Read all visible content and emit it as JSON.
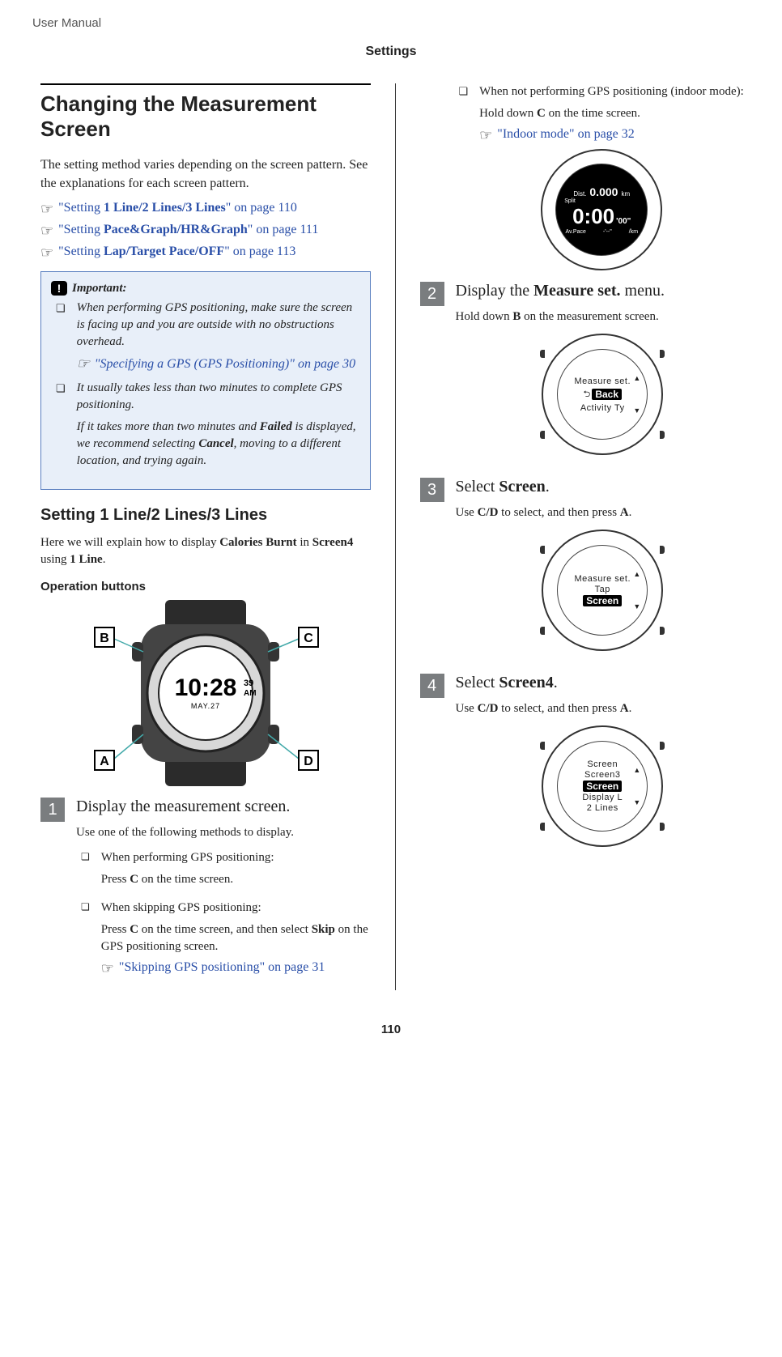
{
  "header": {
    "doc_type": "User Manual",
    "section": "Settings"
  },
  "h1": "Changing the Measurement Screen",
  "intro": "The setting method varies depending on the screen pattern. See the explanations for each screen pattern.",
  "xref1": {
    "prefix": "\"Setting ",
    "bold": "1 Line/2 Lines/3 Lines",
    "suffix": "\" on page 110"
  },
  "xref2": {
    "prefix": "\"Setting ",
    "bold": "Pace&Graph/HR&Graph",
    "suffix": "\" on page 111"
  },
  "xref3": {
    "prefix": "\"Setting ",
    "bold": "Lap/Target Pace/OFF",
    "suffix": "\" on page 113"
  },
  "important": {
    "label": "Important:",
    "item1": {
      "text": "When performing GPS positioning, make sure the screen is facing up and you are outside with no obstructions overhead.",
      "xref": "\"Specifying a GPS (GPS Positioning)\" on page 30"
    },
    "item2": {
      "text": "It usually takes less than two minutes to complete GPS positioning.",
      "text2_a": "If it takes more than two minutes and ",
      "text2_b": "Failed",
      "text2_c": " is displayed, we recommend selecting ",
      "text2_d": "Cancel",
      "text2_e": ", moving to a different location, and trying again."
    }
  },
  "h2": "Setting 1 Line/2 Lines/3 Lines",
  "h2_intro_a": "Here we will explain how to display ",
  "h2_intro_b": "Calories Burnt",
  "h2_intro_c": " in ",
  "h2_intro_d": "Screen4",
  "h2_intro_e": " using ",
  "h2_intro_f": "1 Line",
  "h2_intro_g": ".",
  "op_btn_heading": "Operation buttons",
  "watch_labels": {
    "A": "A",
    "B": "B",
    "C": "C",
    "D": "D",
    "time": "10:28",
    "sec": "39",
    "ampm": "AM",
    "date": "MAY.27"
  },
  "step1": {
    "num": "1",
    "title": "Display the measurement screen.",
    "p": "Use one of the following methods to display.",
    "i1": {
      "head": "When performing GPS positioning:",
      "body_a": "Press ",
      "body_b": "C",
      "body_c": " on the time screen."
    },
    "i2": {
      "head": "When skipping GPS positioning:",
      "body_a": "Press ",
      "body_b": "C",
      "body_c": " on the time screen, and then select ",
      "body_d": "Skip",
      "body_e": " on the GPS positioning screen.",
      "xref": "\"Skipping GPS positioning\" on page 31"
    },
    "i3": {
      "head": "When not performing GPS positioning (indoor mode):",
      "body_a": "Hold down ",
      "body_b": "C",
      "body_c": " on the time screen.",
      "xref": "\"Indoor mode\" on page 32"
    }
  },
  "dark_fig": {
    "dist_lbl": "Dist.",
    "dist_val": "0.000",
    "dist_unit": "km",
    "split_lbl": "Split",
    "time_main": "0:00",
    "time_sec": "'00\"",
    "pace_lbl": "Av.Pace",
    "pace_val": "-'--\"",
    "pace_unit": "/km"
  },
  "step2": {
    "num": "2",
    "title_a": "Display the ",
    "title_b": "Measure set.",
    "title_c": " menu.",
    "p_a": "Hold down ",
    "p_b": "B",
    "p_c": " on the measurement screen.",
    "fig": {
      "header": "Measure set.",
      "hl": "Back",
      "l2_pre": "⮌",
      "sub": "Activity Ty"
    }
  },
  "step3": {
    "num": "3",
    "title_a": "Select ",
    "title_b": "Screen",
    "title_c": ".",
    "p_a": "Use ",
    "p_b": "C/D",
    "p_c": " to select, and then press ",
    "p_d": "A",
    "p_e": ".",
    "fig": {
      "header": "Measure set.",
      "l1": "Tap",
      "hl": "Screen"
    }
  },
  "step4": {
    "num": "4",
    "title_a": "Select ",
    "title_b": "Screen4",
    "title_c": ".",
    "p_a": "Use ",
    "p_b": "C/D",
    "p_c": " to select, and then press ",
    "p_d": "A",
    "p_e": ".",
    "fig": {
      "header": "Screen",
      "l1": "Screen3",
      "hl": "Screen",
      "l3": "Display L",
      "l4": "2 Lines"
    }
  },
  "page_num": "110"
}
